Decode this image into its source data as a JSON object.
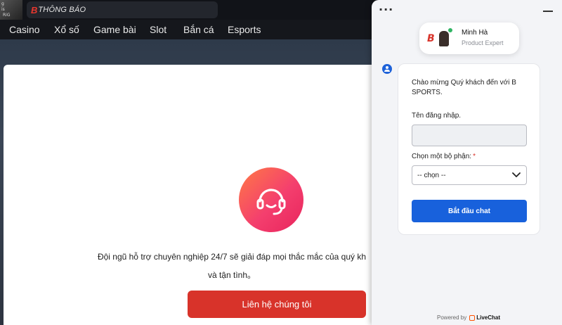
{
  "topbar": {
    "avatar_text": [
      "g",
      "is",
      "RiG"
    ],
    "notice_logo": "B",
    "notice_title": "THÔNG BÁO"
  },
  "nav": {
    "items": [
      {
        "label": "Casino"
      },
      {
        "label": "Xổ số"
      },
      {
        "label": "Game bài"
      },
      {
        "label": "Slot"
      },
      {
        "label": "Bắn cá"
      },
      {
        "label": "Esports"
      }
    ]
  },
  "support": {
    "icon": "headset-icon",
    "description_line1": "Đội ngũ hỗ trợ chuyên nghiệp 24/7 sẽ giải đáp mọi thắc mắc của quý kh",
    "description_line2": "và tận tình。",
    "contact_button": "Liên hệ chúng tôi"
  },
  "livechat": {
    "menu_icon": "more-horizontal-icon",
    "minimize_icon": "minimize-icon",
    "agent": {
      "logo_text": "B",
      "name": "Minh Hà",
      "role": "Product Expert"
    },
    "form": {
      "welcome": "Chào mừng Quý khách đến với B SPORTS.",
      "username_label": "Tên đăng nhập.",
      "username_value": "",
      "department_label": "Chọn một bộ phận:",
      "required_mark": "*",
      "department_selected": "-- chọn --",
      "start_button": "Bắt đầu chat"
    },
    "powered_by": "Powered by",
    "brand": "LiveChat"
  },
  "colors": {
    "accent_red": "#d8332a",
    "chat_blue": "#1861dc",
    "online_green": "#2fb463"
  }
}
